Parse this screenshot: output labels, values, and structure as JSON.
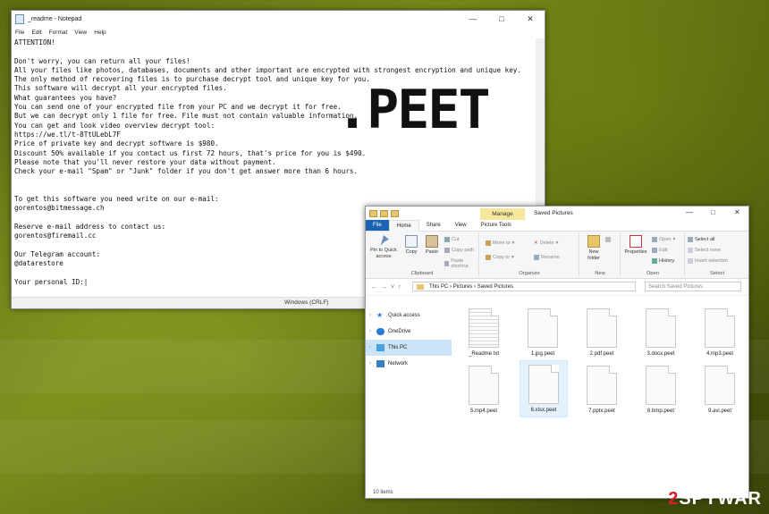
{
  "notepad": {
    "title": "_readme - Notepad",
    "menu": [
      "File",
      "Edit",
      "Format",
      "View",
      "Help"
    ],
    "lines": [
      "ATTENTION!",
      "",
      "Don't worry, you can return all your files!",
      "All your files like photos, databases, documents and other important are encrypted with strongest encryption and unique key.",
      "The only method of recovering files is to purchase decrypt tool and unique key for you.",
      "This software will decrypt all your encrypted files.",
      "What guarantees you have?",
      "You can send one of your encrypted file from your PC and we decrypt it for free.",
      "But we can decrypt only 1 file for free. File must not contain valuable information.",
      "You can get and look video overview decrypt tool:",
      "https://we.tl/t-8TtULebL7F",
      "Price of private key and decrypt software is $980.",
      "Discount 50% available if you contact us first 72 hours, that's price for you is $490.",
      "Please note that you'll never restore your data without payment.",
      "Check your e-mail \"Spam\" or \"Junk\" folder if you don't get answer more than 6 hours.",
      "",
      "",
      "To get this software you need write on our e-mail:",
      "gorentos@bitmessage.ch",
      "",
      "Reserve e-mail address to contact us:",
      "gorentos@firemail.cc",
      "",
      "Our Telegram account:",
      "@datarestore",
      "",
      "Your personal ID:|"
    ],
    "status": "Windows (CRLF)"
  },
  "overlay_text": ".PEET",
  "explorer": {
    "manage_tab": "Manage",
    "title": "Saved Pictures",
    "tabs": [
      "File",
      "Home",
      "Share",
      "View",
      "Picture Tools"
    ],
    "ribbon": {
      "pin": "Pin to Quick access",
      "copy": "Copy",
      "paste": "Paste",
      "cut": "Cut",
      "copy_path": "Copy path",
      "paste_shortcut": "Paste shortcut",
      "clipboard": "Clipboard",
      "move_to": "Move to",
      "copy_to": "Copy to",
      "delete": "Delete",
      "rename": "Rename",
      "organize": "Organize",
      "new_folder": "New folder",
      "new": "New",
      "properties": "Properties",
      "open": "Open",
      "edit": "Edit",
      "history": "History",
      "open_group": "Open",
      "select_all": "Select all",
      "select_none": "Select none",
      "invert_selection": "Invert selection",
      "select_group": "Select"
    },
    "path": [
      "This PC",
      "Pictures",
      "Saved Pictures"
    ],
    "search_placeholder": "Search Saved Pictures",
    "nav": [
      "Quick access",
      "OneDrive",
      "This PC",
      "Network"
    ],
    "files": [
      "_Readme.txt",
      "1.jpg.peet",
      "2.pdf.peet",
      "3.docx.peet",
      "4.mp3.peet",
      "5.mp4.peet",
      "6.xlsx.peet",
      "7.pptx.peet",
      "8.bmp.peet",
      "9.avi.peet"
    ],
    "status": "10 items"
  },
  "watermark": {
    "two": "2",
    "rest": "SPYWAR"
  }
}
